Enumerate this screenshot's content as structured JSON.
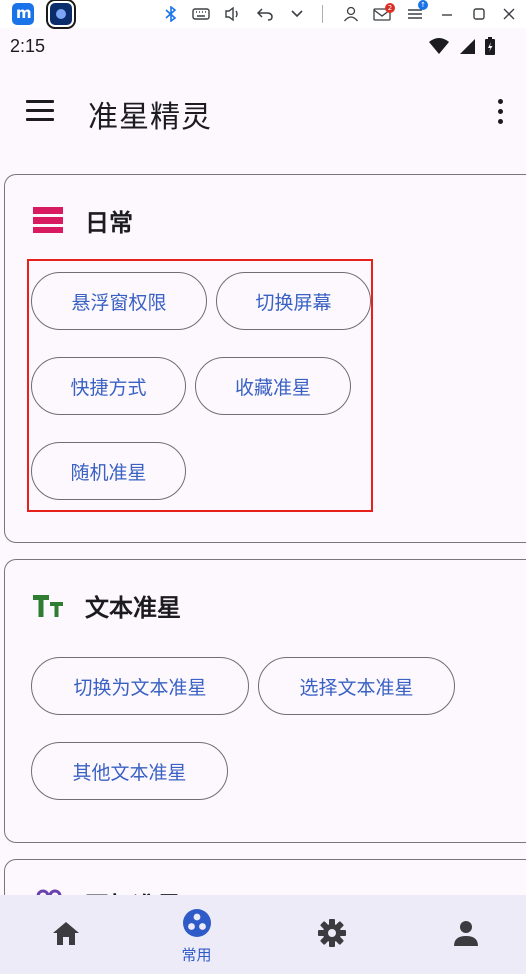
{
  "host_taskbar": {
    "mail_badge": "2"
  },
  "status_bar": {
    "time": "2:15"
  },
  "app_bar": {
    "title": "准星精灵"
  },
  "sections": [
    {
      "title": "日常",
      "icon": "view-list-icon",
      "icon_color": "#d81b60",
      "chips": [
        "悬浮窗权限",
        "切换屏幕",
        "快捷方式",
        "收藏准星",
        "随机准星"
      ]
    },
    {
      "title": "文本准星",
      "icon": "text-format-icon",
      "icon_color": "#2e7d32",
      "chips": [
        "切换为文本准星",
        "选择文本准星",
        "其他文本准星"
      ]
    },
    {
      "title": "图标准星",
      "icon": "emoji-icon",
      "icon_color": "#6a3fb0"
    }
  ],
  "bottom_nav": {
    "items": [
      {
        "icon": "home-icon"
      },
      {
        "icon": "apps-icon",
        "label": "常用",
        "active": true
      },
      {
        "icon": "settings-icon"
      },
      {
        "icon": "account-icon"
      }
    ]
  },
  "colors": {
    "accent": "#2f5bc8",
    "chip_text": "#3a62c4",
    "highlight": "#e8201d",
    "nav_background": "#ecebf7"
  }
}
